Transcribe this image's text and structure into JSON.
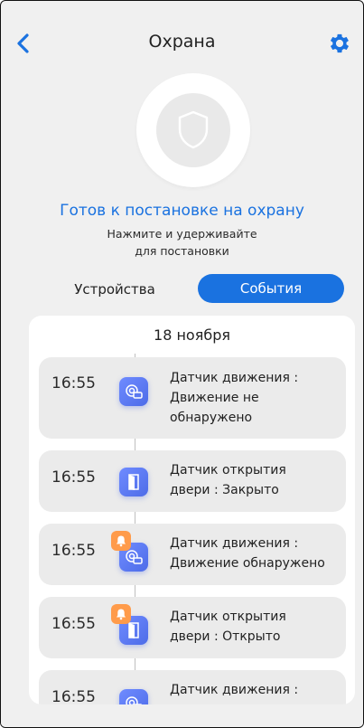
{
  "header": {
    "title": "Охрана"
  },
  "status": {
    "title": "Готов к постановке на охрану",
    "hint_line1": "Нажмите и удерживайте",
    "hint_line2": "для постановки"
  },
  "tabs": {
    "devices": "Устройства",
    "events": "События",
    "active": "events"
  },
  "events": {
    "date": "18 ноября",
    "items": [
      {
        "time": "16:55",
        "line1": "Датчик движения :",
        "line2": "Движение не",
        "line3": "обнаружено",
        "icon": "motion-sensor-icon",
        "alarm": false
      },
      {
        "time": "16:55",
        "line1": "Датчик открытия",
        "line2": "двери : Закрыто",
        "icon": "door-sensor-icon",
        "alarm": false
      },
      {
        "time": "16:55",
        "line1": "Датчик движения :",
        "line2": "Движение обнаружено",
        "icon": "motion-sensor-icon",
        "alarm": true
      },
      {
        "time": "16:55",
        "line1": "Датчик открытия",
        "line2": "двери : Открыто",
        "icon": "door-sensor-icon",
        "alarm": true
      },
      {
        "time": "16:55",
        "line1": "Датчик движения :",
        "icon": "motion-sensor-icon",
        "alarm": false
      }
    ]
  },
  "colors": {
    "accent": "#1a72e0",
    "alarm": "#ff9b4a",
    "background": "#f0f0f0",
    "card": "#ffffff",
    "event_bg": "#ebebeb"
  }
}
